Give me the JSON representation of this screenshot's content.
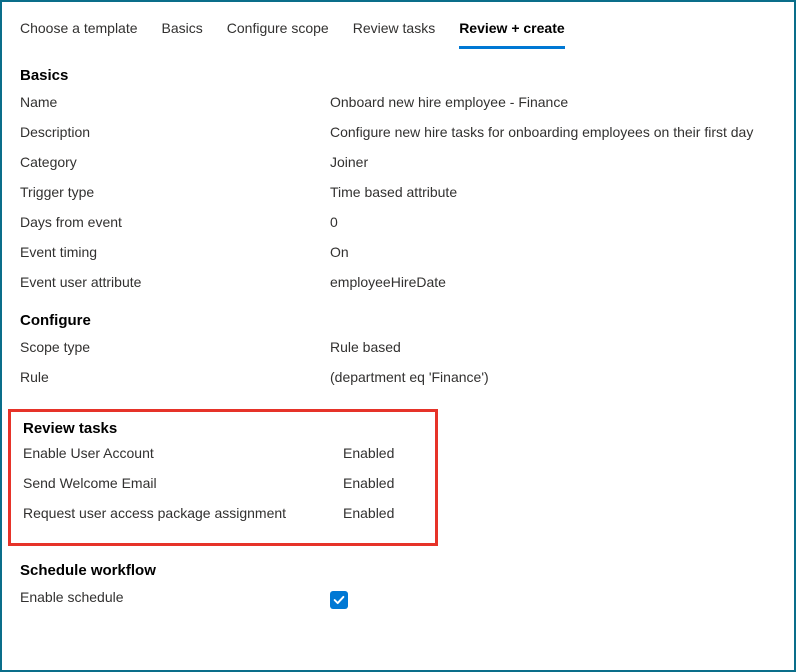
{
  "tabs": [
    {
      "label": "Choose a template",
      "active": false
    },
    {
      "label": "Basics",
      "active": false
    },
    {
      "label": "Configure scope",
      "active": false
    },
    {
      "label": "Review tasks",
      "active": false
    },
    {
      "label": "Review + create",
      "active": true
    }
  ],
  "sections": {
    "basics": {
      "heading": "Basics",
      "rows": [
        {
          "label": "Name",
          "value": "Onboard new hire employee - Finance"
        },
        {
          "label": "Description",
          "value": "Configure new hire tasks for onboarding employees on their first day"
        },
        {
          "label": "Category",
          "value": "Joiner"
        },
        {
          "label": "Trigger type",
          "value": "Time based attribute"
        },
        {
          "label": "Days from event",
          "value": "0"
        },
        {
          "label": "Event timing",
          "value": "On"
        },
        {
          "label": "Event user attribute",
          "value": "employeeHireDate"
        }
      ]
    },
    "configure": {
      "heading": "Configure",
      "rows": [
        {
          "label": "Scope type",
          "value": "Rule based"
        },
        {
          "label": "Rule",
          "value": " (department eq 'Finance')"
        }
      ]
    },
    "review_tasks": {
      "heading": "Review tasks",
      "rows": [
        {
          "label": "Enable User Account",
          "value": "Enabled"
        },
        {
          "label": "Send Welcome Email",
          "value": "Enabled"
        },
        {
          "label": "Request user access package assignment",
          "value": "Enabled"
        }
      ]
    },
    "schedule": {
      "heading": "Schedule workflow",
      "enable_label": "Enable schedule",
      "enable_checked": true
    }
  }
}
